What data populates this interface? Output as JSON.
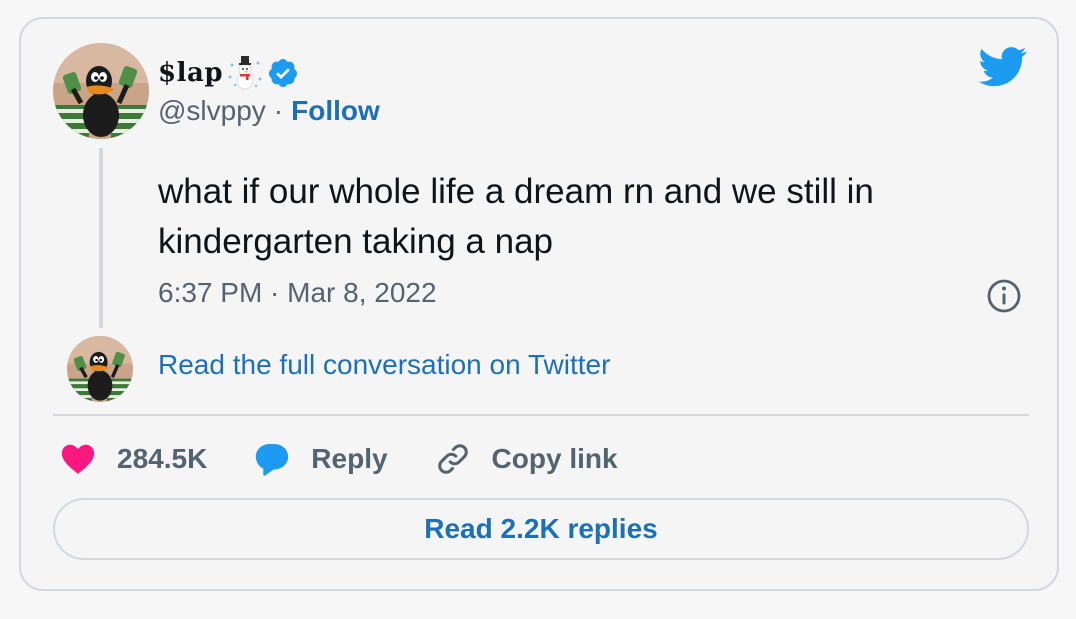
{
  "author": {
    "display_name": "$lap",
    "handle": "@slvppy",
    "separator": "·",
    "follow_label": "Follow",
    "verified": true,
    "name_emoji": "snowman-icon"
  },
  "tweet": {
    "text": "what if our whole life a dream rn and we still in kindergarten taking a nap",
    "timestamp": "6:37 PM · Mar 8, 2022"
  },
  "conversation": {
    "link_label": "Read the full conversation on Twitter"
  },
  "actions": {
    "like_count": "284.5K",
    "reply_label": "Reply",
    "copy_label": "Copy link"
  },
  "replies_button": {
    "label": "Read 2.2K replies"
  },
  "colors": {
    "accent": "#1d9bf0",
    "link": "#1d6fb8",
    "like": "#f91880",
    "text": "#0f1419",
    "muted": "#536471",
    "border": "#cfd9de"
  },
  "icons": {
    "brand": "twitter-bird-icon",
    "verified": "verified-badge-icon",
    "info": "info-icon",
    "like": "heart-icon",
    "reply": "speech-bubble-icon",
    "copy": "link-icon"
  }
}
